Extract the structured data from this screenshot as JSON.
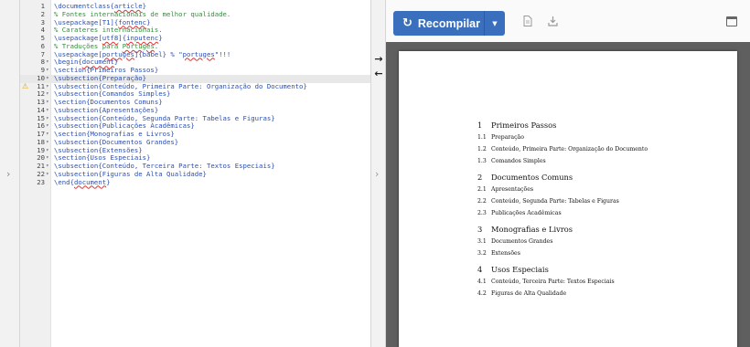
{
  "editor": {
    "active_line": 10,
    "warning_line": 11,
    "lines": [
      {
        "n": "1",
        "fold": false,
        "parts": [
          {
            "t": "\\documentclass{",
            "c": "c-cmd"
          },
          {
            "t": "article",
            "c": "c-cmd sq"
          },
          {
            "t": "}",
            "c": "c-cmd"
          }
        ]
      },
      {
        "n": "2",
        "fold": false,
        "parts": [
          {
            "t": "% Fontes internacionais de melhor qualidade.",
            "c": "c-comment"
          }
        ]
      },
      {
        "n": "3",
        "fold": false,
        "parts": [
          {
            "t": "\\usepackage[T1]{",
            "c": "c-cmd"
          },
          {
            "t": "fontenc",
            "c": "c-cmd sq"
          },
          {
            "t": "}",
            "c": "c-cmd"
          }
        ]
      },
      {
        "n": "4",
        "fold": false,
        "parts": [
          {
            "t": "% Carateres internacionais.",
            "c": "c-comment"
          }
        ]
      },
      {
        "n": "5",
        "fold": false,
        "parts": [
          {
            "t": "\\usepackage[",
            "c": "c-cmd"
          },
          {
            "t": "utf8",
            "c": "c-cmd sq"
          },
          {
            "t": "]{",
            "c": "c-cmd"
          },
          {
            "t": "inputenc",
            "c": "c-cmd sq"
          },
          {
            "t": "}",
            "c": "c-cmd"
          }
        ]
      },
      {
        "n": "6",
        "fold": false,
        "parts": [
          {
            "t": "% Traduções para ",
            "c": "c-comment"
          },
          {
            "t": "Portugês",
            "c": "c-comment sq"
          },
          {
            "t": ".",
            "c": "c-comment"
          }
        ]
      },
      {
        "n": "7",
        "fold": false,
        "parts": [
          {
            "t": "\\usepackage[",
            "c": "c-cmd"
          },
          {
            "t": "portuges",
            "c": "c-cmd sq"
          },
          {
            "t": "]{babel} % \"",
            "c": "c-cmd"
          },
          {
            "t": "portuges",
            "c": "c-cmd sq"
          },
          {
            "t": "\"!!!",
            "c": "c-cmd"
          }
        ]
      },
      {
        "n": "8",
        "fold": true,
        "parts": [
          {
            "t": "\\begin{",
            "c": "c-cmd"
          },
          {
            "t": "document",
            "c": "c-cmd sq"
          },
          {
            "t": "}",
            "c": "c-cmd"
          }
        ]
      },
      {
        "n": "9",
        "fold": true,
        "parts": [
          {
            "t": "\\section{Primeiros Passos}",
            "c": "c-cmd"
          }
        ]
      },
      {
        "n": "10",
        "fold": true,
        "parts": [
          {
            "t": "\\subsection{Preparação}",
            "c": "c-cmd"
          }
        ]
      },
      {
        "n": "11",
        "fold": true,
        "parts": [
          {
            "t": "\\subsection{Conteúdo, Primeira Parte: Organização do Documento}",
            "c": "c-cmd"
          }
        ]
      },
      {
        "n": "12",
        "fold": true,
        "parts": [
          {
            "t": "\\subsection{Comandos Simples}",
            "c": "c-cmd"
          }
        ]
      },
      {
        "n": "13",
        "fold": true,
        "parts": [
          {
            "t": "\\section{Documentos Comuns}",
            "c": "c-cmd"
          }
        ]
      },
      {
        "n": "14",
        "fold": true,
        "parts": [
          {
            "t": "\\subsection{Apresentações}",
            "c": "c-cmd"
          }
        ]
      },
      {
        "n": "15",
        "fold": true,
        "parts": [
          {
            "t": "\\subsection{Conteúdo, Segunda Parte: Tabelas e Figuras}",
            "c": "c-cmd"
          }
        ]
      },
      {
        "n": "16",
        "fold": true,
        "parts": [
          {
            "t": "\\subsection{Publicações Acadêmicas}",
            "c": "c-cmd"
          }
        ]
      },
      {
        "n": "17",
        "fold": true,
        "parts": [
          {
            "t": "\\section{Monografias e Livros}",
            "c": "c-cmd"
          }
        ]
      },
      {
        "n": "18",
        "fold": true,
        "parts": [
          {
            "t": "\\subsection{Documentos Grandes}",
            "c": "c-cmd"
          }
        ]
      },
      {
        "n": "19",
        "fold": true,
        "parts": [
          {
            "t": "\\subsection{Extensões}",
            "c": "c-cmd"
          }
        ]
      },
      {
        "n": "20",
        "fold": true,
        "parts": [
          {
            "t": "\\section{Usos Especiais}",
            "c": "c-cmd"
          }
        ]
      },
      {
        "n": "21",
        "fold": true,
        "parts": [
          {
            "t": "\\subsection{Conteúdo, Terceira Parte: Textos Especiais}",
            "c": "c-cmd"
          }
        ]
      },
      {
        "n": "22",
        "fold": true,
        "parts": [
          {
            "t": "\\subsection{Figuras de Alta Qualidade}",
            "c": "c-cmd"
          }
        ]
      },
      {
        "n": "23",
        "fold": false,
        "parts": [
          {
            "t": "\\end{",
            "c": "c-cmd"
          },
          {
            "t": "document",
            "c": "c-cmd sq"
          },
          {
            "t": "}",
            "c": "c-cmd"
          }
        ]
      }
    ]
  },
  "toolbar": {
    "recompile_label": "Recompilar"
  },
  "document": {
    "sections": [
      {
        "num": "1",
        "title": "Primeiros Passos",
        "subs": [
          {
            "num": "1.1",
            "title": "Preparação"
          },
          {
            "num": "1.2",
            "title": "Conteúdo, Primeira Parte: Organização do Documento"
          },
          {
            "num": "1.3",
            "title": "Comandos Simples"
          }
        ]
      },
      {
        "num": "2",
        "title": "Documentos Comuns",
        "subs": [
          {
            "num": "2.1",
            "title": "Apresentações"
          },
          {
            "num": "2.2",
            "title": "Conteúdo, Segunda Parte: Tabelas e Figuras"
          },
          {
            "num": "2.3",
            "title": "Publicações Acadêmicas"
          }
        ]
      },
      {
        "num": "3",
        "title": "Monografias e Livros",
        "subs": [
          {
            "num": "3.1",
            "title": "Documentos Grandes"
          },
          {
            "num": "3.2",
            "title": "Extensões"
          }
        ]
      },
      {
        "num": "4",
        "title": "Usos Especiais",
        "subs": [
          {
            "num": "4.1",
            "title": "Conteúdo, Terceira Parte: Textos Especiais"
          },
          {
            "num": "4.2",
            "title": "Figuras de Alta Qualidade"
          }
        ]
      }
    ]
  },
  "colors": {
    "accent": "#3a6fbe",
    "command": "#2b4fb0",
    "comment": "#2f8f3a",
    "warning": "#e0a600"
  },
  "icons": {
    "recompile": "refresh-icon",
    "dropdown": "caret-down-icon",
    "logs": "document-icon",
    "download": "download-icon",
    "maximize": "window-icon",
    "sync_to_pdf": "arrow-right-icon",
    "sync_to_code": "arrow-left-icon"
  }
}
